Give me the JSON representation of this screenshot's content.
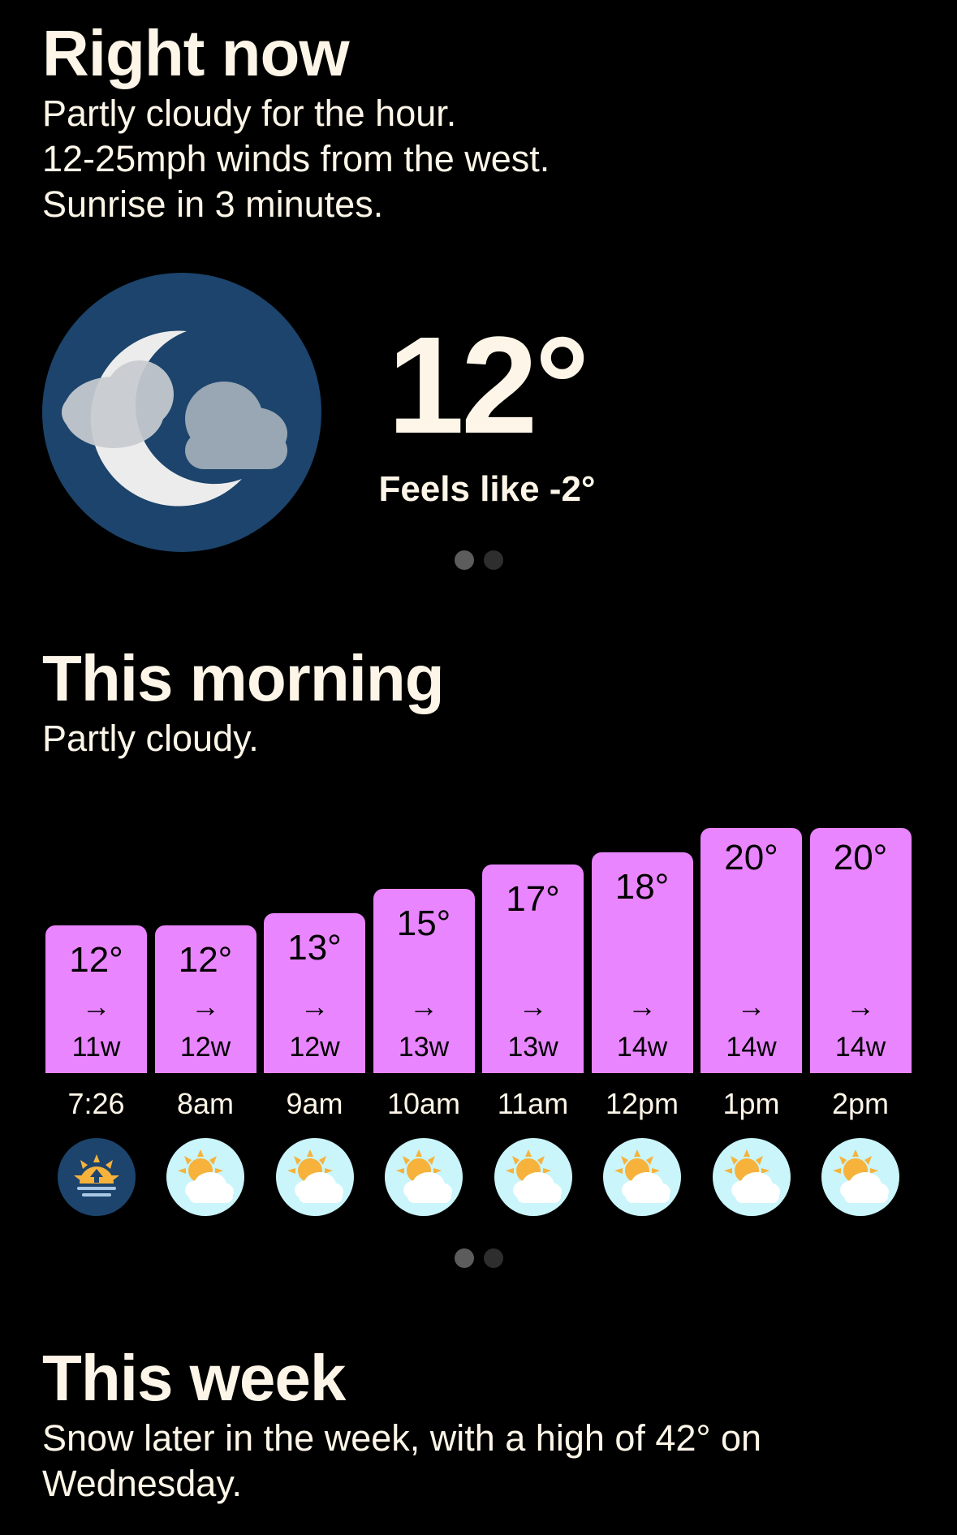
{
  "now": {
    "title": "Right now",
    "lines": [
      "Partly cloudy for the hour.",
      "12-25mph winds from the west.",
      "Sunrise in 3 minutes."
    ],
    "temperature": "12°",
    "feels_like": "Feels like -2°",
    "icon": "moon-cloud-icon"
  },
  "morning": {
    "title": "This morning",
    "summary": "Partly cloudy."
  },
  "week": {
    "title": "This week",
    "summary": "Snow later in the week, with a high of 42° on Wednesday."
  },
  "colors": {
    "background": "#000000",
    "text": "#fdf6e8",
    "bar": "#e985ff",
    "moon_circle": "#1c446c",
    "sun_circle": "#c9f5fb"
  },
  "chart_data": {
    "type": "bar",
    "categories": [
      "7:26",
      "8am",
      "9am",
      "10am",
      "11am",
      "12pm",
      "1pm",
      "2pm"
    ],
    "series": [
      {
        "values": [
          12,
          12,
          13,
          15,
          17,
          18,
          20,
          20
        ]
      }
    ],
    "value_labels": [
      "12°",
      "12°",
      "13°",
      "15°",
      "17°",
      "18°",
      "20°",
      "20°"
    ],
    "wind_labels": [
      "11w",
      "12w",
      "12w",
      "13w",
      "13w",
      "14w",
      "14w",
      "14w"
    ],
    "wind_arrow": "→",
    "icons": [
      "sunrise-icon",
      "partly-sunny-icon",
      "partly-sunny-icon",
      "partly-sunny-icon",
      "partly-sunny-icon",
      "partly-sunny-icon",
      "partly-sunny-icon",
      "partly-sunny-icon"
    ]
  }
}
